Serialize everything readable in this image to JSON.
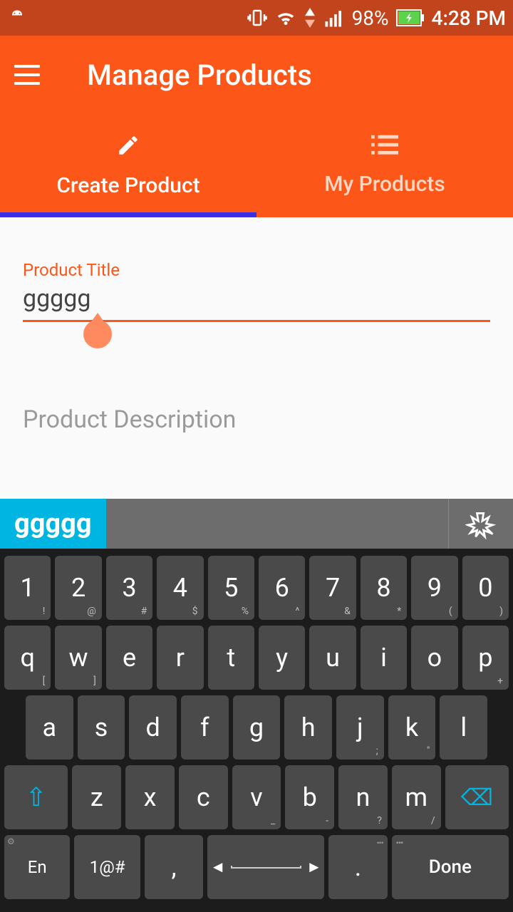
{
  "status": {
    "battery": "98%",
    "time": "4:28 PM"
  },
  "header": {
    "title": "Manage Products"
  },
  "tabs": {
    "create": "Create Product",
    "mine": "My Products"
  },
  "form": {
    "title_label": "Product Title",
    "title_value": "ggggg",
    "desc_placeholder": "Product Description"
  },
  "keyboard": {
    "suggestion": "ggggg",
    "row1": [
      {
        "m": "1",
        "s": "!"
      },
      {
        "m": "2",
        "s": "@"
      },
      {
        "m": "3",
        "s": "#"
      },
      {
        "m": "4",
        "s": "$"
      },
      {
        "m": "5",
        "s": "%"
      },
      {
        "m": "6",
        "s": "^"
      },
      {
        "m": "7",
        "s": "&"
      },
      {
        "m": "8",
        "s": "*"
      },
      {
        "m": "9",
        "s": "("
      },
      {
        "m": "0",
        "s": ")"
      }
    ],
    "row2": [
      {
        "m": "q",
        "s": "["
      },
      {
        "m": "w",
        "s": "]"
      },
      {
        "m": "e",
        "s": ""
      },
      {
        "m": "r",
        "s": ""
      },
      {
        "m": "t",
        "s": ""
      },
      {
        "m": "y",
        "s": ""
      },
      {
        "m": "u",
        "s": ""
      },
      {
        "m": "i",
        "s": ""
      },
      {
        "m": "o",
        "s": ""
      },
      {
        "m": "p",
        "s": "+"
      }
    ],
    "row3": [
      {
        "m": "a",
        "s": ""
      },
      {
        "m": "s",
        "s": ""
      },
      {
        "m": "d",
        "s": ""
      },
      {
        "m": "f",
        "s": ""
      },
      {
        "m": "g",
        "s": ""
      },
      {
        "m": "h",
        "s": ""
      },
      {
        "m": "j",
        "s": ";"
      },
      {
        "m": "k",
        "s": "\""
      },
      {
        "m": "l",
        "s": ""
      }
    ],
    "row4": [
      {
        "m": "z",
        "s": ""
      },
      {
        "m": "x",
        "s": ""
      },
      {
        "m": "c",
        "s": ""
      },
      {
        "m": "v",
        "s": "_"
      },
      {
        "m": "b",
        "s": "-"
      },
      {
        "m": "n",
        "s": "?"
      },
      {
        "m": "m",
        "s": "/"
      }
    ],
    "en": "En",
    "sym": "1@#",
    "comma": ",",
    "period": ".",
    "done": "Done"
  }
}
